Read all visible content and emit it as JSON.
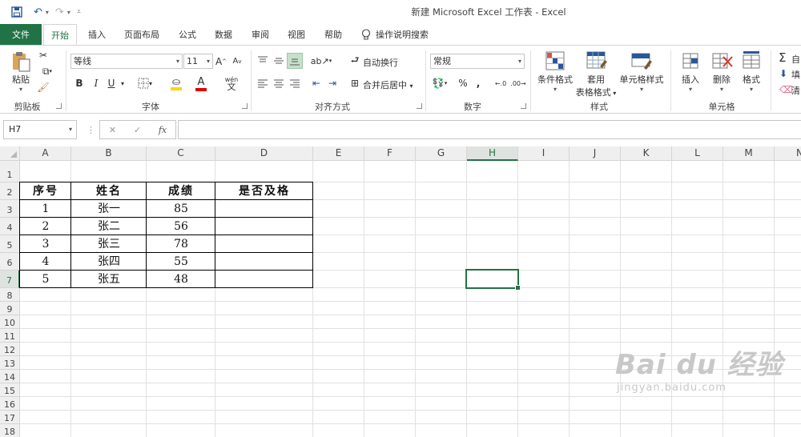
{
  "window": {
    "title": "新建 Microsoft Excel 工作表  -  Excel"
  },
  "ribbon": {
    "tabs": [
      "文件",
      "开始",
      "插入",
      "页面布局",
      "公式",
      "数据",
      "审阅",
      "视图",
      "帮助"
    ],
    "tell_me": "操作说明搜索",
    "clipboard": {
      "paste": "粘贴",
      "group": "剪贴板"
    },
    "font": {
      "name": "等线",
      "size": "11",
      "bold": "B",
      "italic": "I",
      "underline": "U",
      "group": "字体",
      "font_color": "#e00000",
      "fill_color": "#ffd500"
    },
    "alignment": {
      "wrap": "自动换行",
      "merge": "合并后居中",
      "group": "对齐方式"
    },
    "number": {
      "format": "常规",
      "percent": "%",
      "comma": ",",
      "group": "数字"
    },
    "styles": {
      "conditional": "条件格式",
      "table_line1": "套用",
      "table_line2": "表格格式",
      "cell_styles": "单元格样式",
      "group": "样式"
    },
    "cells": {
      "insert": "插入",
      "delete": "删除",
      "format": "格式",
      "group": "单元格"
    },
    "editing": {
      "autosum": "自",
      "fill": "填",
      "clear": "清"
    }
  },
  "formula_bar": {
    "name_box": "H7",
    "fx": "fx",
    "content": ""
  },
  "sheet": {
    "columns": [
      "A",
      "B",
      "C",
      "D",
      "E",
      "F",
      "G",
      "H",
      "I",
      "J",
      "K",
      "L",
      "M",
      "N"
    ],
    "selected_column": "H",
    "selected_row": "7",
    "rows": [
      "1",
      "2",
      "3",
      "4",
      "5",
      "6",
      "7",
      "8",
      "9",
      "10",
      "11",
      "12",
      "13",
      "14",
      "15",
      "16",
      "17",
      "18"
    ],
    "table": {
      "headers": [
        "序号",
        "姓名",
        "成绩",
        "是否及格"
      ],
      "rows": [
        [
          "1",
          "张一",
          "85",
          ""
        ],
        [
          "2",
          "张二",
          "56",
          ""
        ],
        [
          "3",
          "张三",
          "78",
          ""
        ],
        [
          "4",
          "张四",
          "55",
          ""
        ],
        [
          "5",
          "张五",
          "48",
          ""
        ]
      ]
    }
  },
  "watermark": {
    "brand": "Bai  du 经验",
    "url": "jingyan.baidu.com"
  },
  "colors": {
    "excel_green": "#217346",
    "quick_access": "#2b579a"
  }
}
